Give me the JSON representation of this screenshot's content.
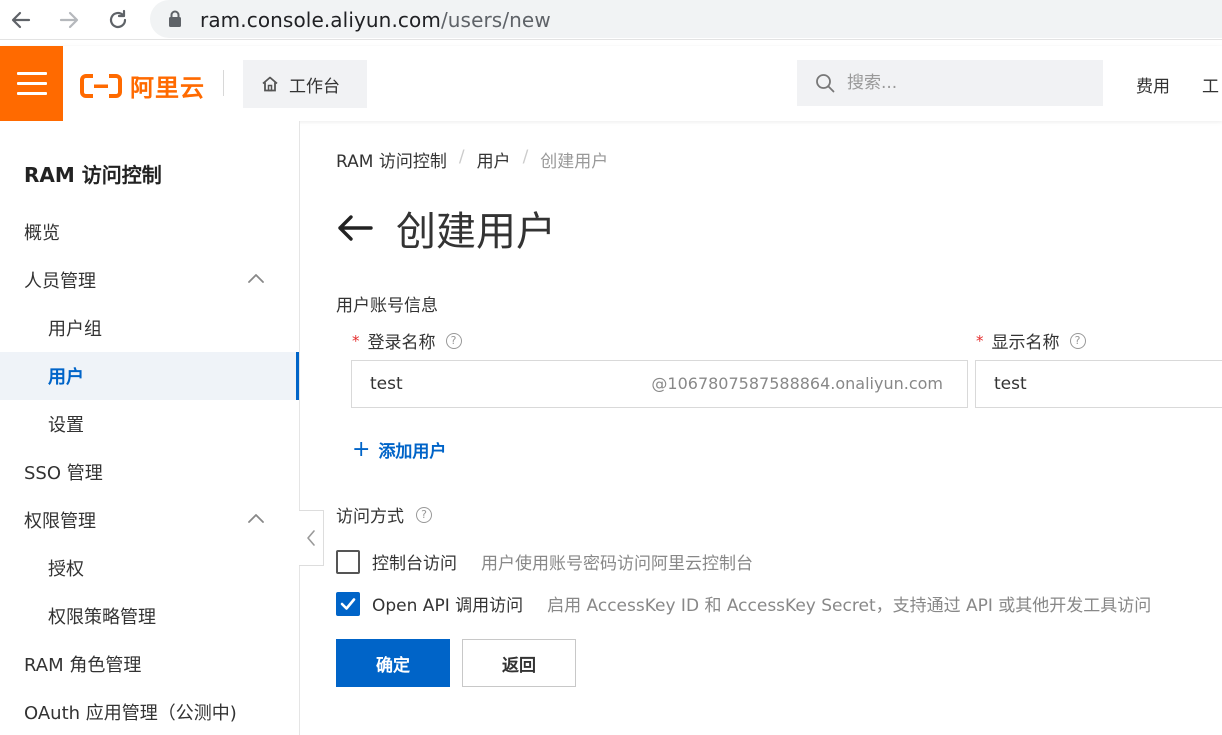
{
  "browser": {
    "url_host": "ram.console.aliyun.com",
    "url_path": "/users/new"
  },
  "header": {
    "logo_text": "阿里云",
    "workbench_label": "工作台",
    "search_placeholder": "搜索...",
    "links": [
      "费用",
      "工"
    ]
  },
  "sidebar": {
    "title": "RAM 访问控制",
    "items": [
      {
        "label": "概览",
        "level": 1
      },
      {
        "label": "人员管理",
        "level": 1,
        "expanded": true
      },
      {
        "label": "用户组",
        "level": 2
      },
      {
        "label": "用户",
        "level": 2,
        "active": true
      },
      {
        "label": "设置",
        "level": 2
      },
      {
        "label": "SSO 管理",
        "level": 1
      },
      {
        "label": "权限管理",
        "level": 1,
        "expanded": true
      },
      {
        "label": "授权",
        "level": 2
      },
      {
        "label": "权限策略管理",
        "level": 2
      },
      {
        "label": "RAM 角色管理",
        "level": 1
      },
      {
        "label": "OAuth 应用管理（公测中)",
        "level": 1
      }
    ]
  },
  "breadcrumb": [
    "RAM 访问控制",
    "用户",
    "创建用户"
  ],
  "page_title": "创建用户",
  "form": {
    "section_account": "用户账号信息",
    "login_name_label": "登录名称",
    "login_name_value": "test",
    "login_name_suffix": "@1067807587588864.onaliyun.com",
    "display_name_label": "显示名称",
    "display_name_value": "test",
    "add_user_label": "添加用户",
    "section_access": "访问方式",
    "access_options": [
      {
        "label": "控制台访问",
        "description": "用户使用账号密码访问阿里云控制台",
        "checked": false
      },
      {
        "label": "Open API 调用访问",
        "description": "启用 AccessKey ID 和 AccessKey Secret，支持通过 API 或其他开发工具访问",
        "checked": true
      }
    ],
    "confirm_label": "确定",
    "back_label": "返回"
  },
  "colors": {
    "brand_orange": "#ff6a00",
    "primary_blue": "#0064c8",
    "required_red": "#e52d2d"
  }
}
